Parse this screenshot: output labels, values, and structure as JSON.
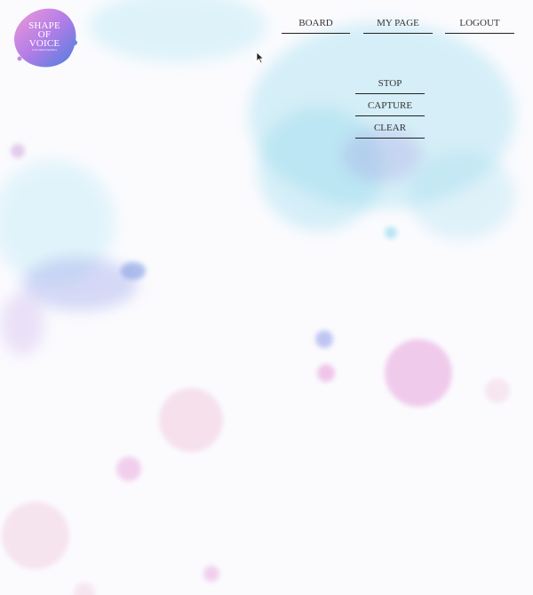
{
  "logo": {
    "line1": "SHAPE",
    "line2": "OF",
    "line3": "VOICE",
    "subtitle": "voice visual experience"
  },
  "nav": {
    "board": "BOARD",
    "mypage": "MY PAGE",
    "logout": "LOGOUT"
  },
  "controls": {
    "stop": "STOP",
    "capture": "CAPTURE",
    "clear": "CLEAR"
  },
  "colors": {
    "background": "#fbfbfe",
    "watercolor_blue": "#8fd8ec",
    "watercolor_purple": "#9a8fe0",
    "watercolor_pink": "#e59ad8"
  }
}
